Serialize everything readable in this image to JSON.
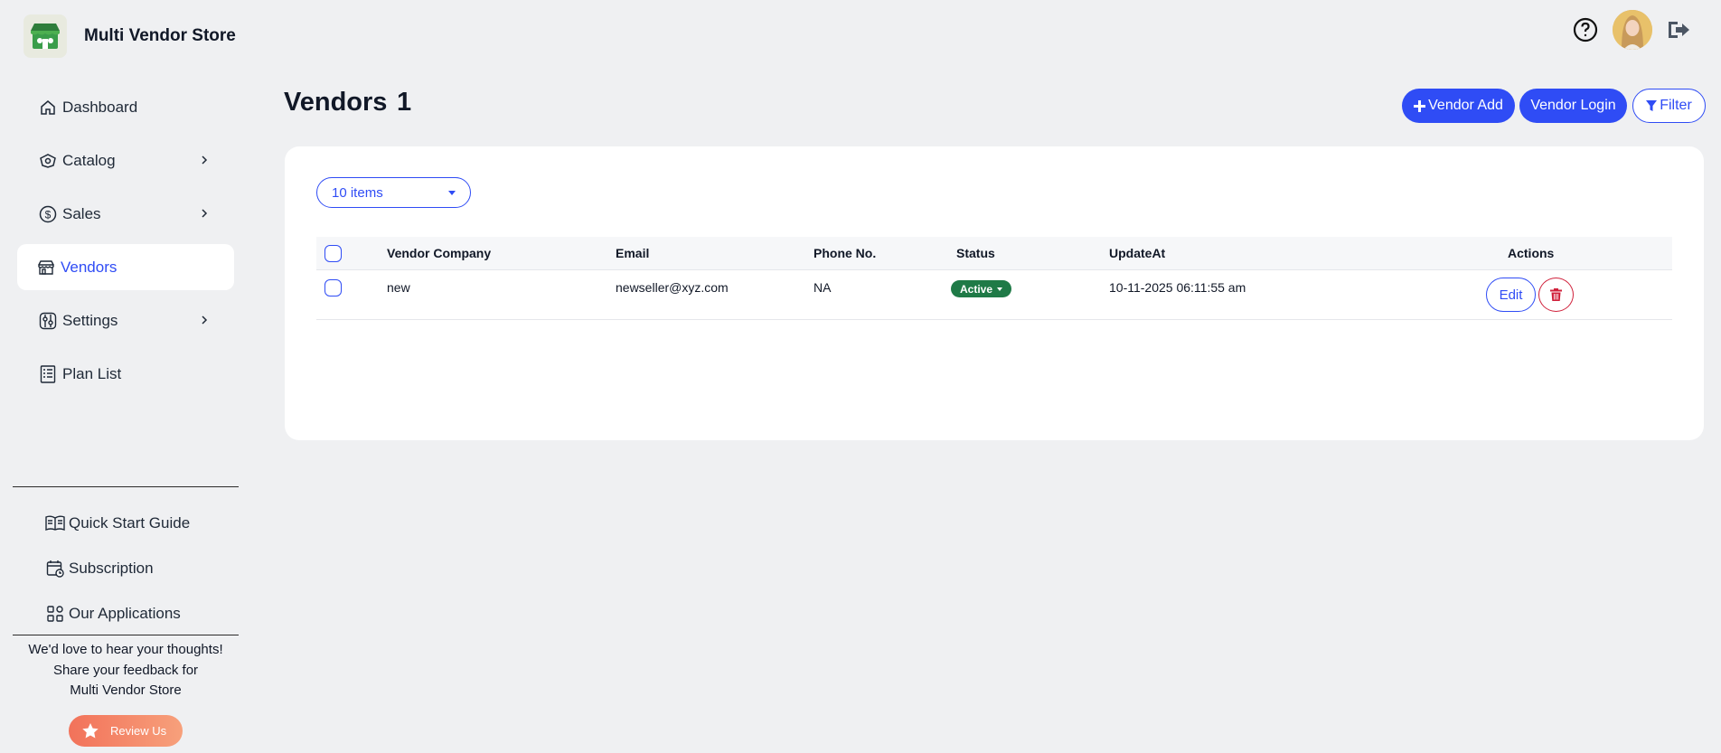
{
  "app": {
    "title": "Multi Vendor Store"
  },
  "sidebar": {
    "items": [
      {
        "label": "Dashboard",
        "icon": "home-icon",
        "has_chevron": false,
        "active": false
      },
      {
        "label": "Catalog",
        "icon": "catalog-icon",
        "has_chevron": true,
        "active": false
      },
      {
        "label": "Sales",
        "icon": "dollar-icon",
        "has_chevron": true,
        "active": false
      },
      {
        "label": "Vendors",
        "icon": "store-icon",
        "has_chevron": false,
        "active": true
      },
      {
        "label": "Settings",
        "icon": "settings-icon",
        "has_chevron": true,
        "active": false
      },
      {
        "label": "Plan List",
        "icon": "list-icon",
        "has_chevron": false,
        "active": false
      }
    ],
    "bottom_links": [
      {
        "label": "Quick Start Guide",
        "icon": "book-icon"
      },
      {
        "label": "Subscription",
        "icon": "calendar-icon"
      },
      {
        "label": "Our Applications",
        "icon": "apps-icon"
      }
    ],
    "feedback": {
      "line1": "We'd love to hear your thoughts!",
      "line2": "Share your feedback for",
      "line3": "Multi Vendor Store",
      "button": "Review Us"
    }
  },
  "header": {
    "help_icon": "help-icon",
    "logout_icon": "logout-icon"
  },
  "page": {
    "title": "Vendors",
    "count": "1",
    "buttons": {
      "vendor_add": "Vendor Add",
      "vendor_login": "Vendor Login",
      "filter": "Filter"
    }
  },
  "table": {
    "page_size": "10 items",
    "columns": [
      "Vendor Company",
      "Email",
      "Phone No.",
      "Status",
      "UpdateAt",
      "Actions"
    ],
    "rows": [
      {
        "company": "new",
        "email": "newseller@xyz.com",
        "phone": "NA",
        "status": "Active",
        "updated_at": "10-11-2025 06:11:55 am",
        "edit": "Edit"
      }
    ]
  },
  "colors": {
    "accent": "#2f4cf5",
    "status_active": "#1f7a47",
    "danger": "#d0213b",
    "background": "#eff0f2"
  }
}
